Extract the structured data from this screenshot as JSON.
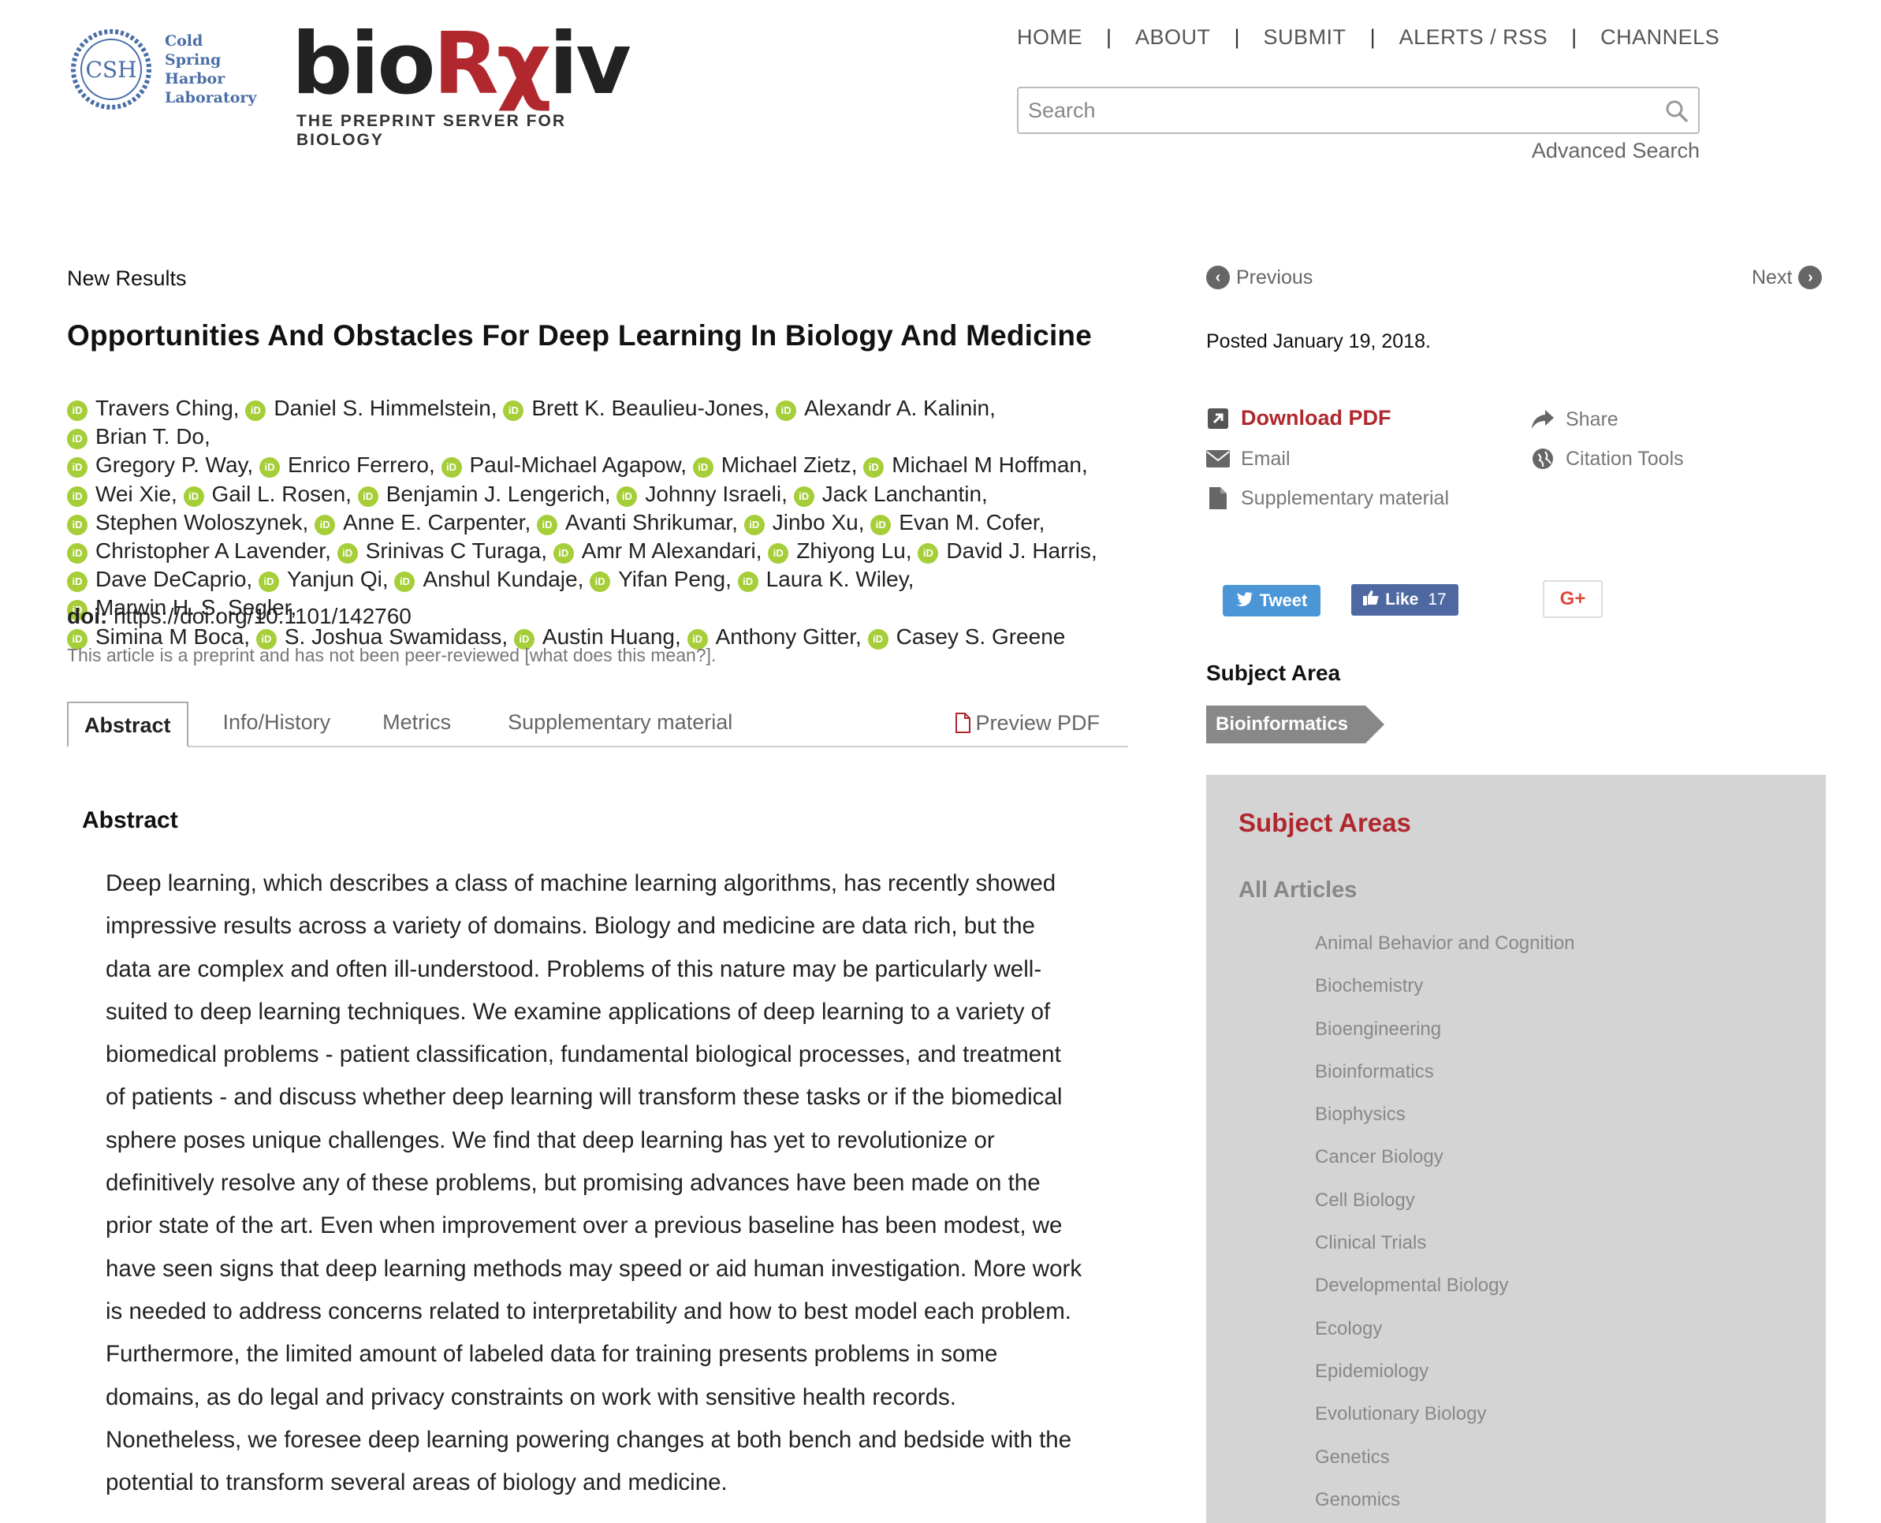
{
  "header": {
    "csh_text": [
      "Cold",
      "Spring",
      "Harbor",
      "Laboratory"
    ],
    "csh_monogram": "CSH",
    "brand_pre": "bio",
    "brand_accent": "Rχ",
    "brand_post": "iv",
    "tagline": "THE PREPRINT SERVER FOR BIOLOGY",
    "nav": [
      "HOME",
      "ABOUT",
      "SUBMIT",
      "ALERTS / RSS",
      "CHANNELS"
    ],
    "nav_separator": "|",
    "search_placeholder": "Search",
    "advanced_search": "Advanced Search",
    "icons": {
      "search": "search-icon"
    }
  },
  "article": {
    "label": "New Results",
    "title": "Opportunities And Obstacles For Deep Learning In Biology And Medicine",
    "orcid_badge": "iD",
    "authors": [
      "Travers Ching,",
      "Daniel S. Himmelstein,",
      "Brett K. Beaulieu-Jones,",
      "Alexandr A. Kalinin,",
      "Brian T. Do,",
      "Gregory P. Way,",
      "Enrico Ferrero,",
      "Paul-Michael Agapow,",
      "Michael Zietz,",
      "Michael M Hoffman,",
      "Wei Xie,",
      "Gail L. Rosen,",
      "Benjamin J. Lengerich,",
      "Johnny Israeli,",
      "Jack Lanchantin,",
      "Stephen Woloszynek,",
      "Anne E. Carpenter,",
      "Avanti Shrikumar,",
      "Jinbo Xu,",
      "Evan M. Cofer,",
      "Christopher A Lavender,",
      "Srinivas C Turaga,",
      "Amr M Alexandari,",
      "Zhiyong Lu,",
      "David J. Harris,",
      "Dave DeCaprio,",
      "Yanjun Qi,",
      "Anshul Kundaje,",
      "Yifan Peng,",
      "Laura K. Wiley,",
      "Marwin H. S. Segler,",
      "Simina M Boca,",
      "S. Joshua Swamidass,",
      "Austin Huang,",
      "Anthony Gitter,",
      "Casey S. Greene"
    ],
    "doi_label": "doi:",
    "doi_url": "https://doi.org/10.1101/142760",
    "preprint_note": "This article is a preprint and has not been peer-reviewed",
    "preprint_link": "[what does this mean?].",
    "tabs": [
      "Abstract",
      "Info/History",
      "Metrics",
      "Supplementary material"
    ],
    "preview_pdf": "Preview PDF",
    "abstract_heading": "Abstract",
    "abstract_lines": [
      "Deep learning, which describes a class of machine learning algorithms, has recently showed",
      "impressive results across a variety of domains. Biology and medicine are data rich, but the",
      "data are complex and often ill-understood. Problems of this nature may be particularly well-",
      "suited to deep learning techniques. We examine applications of deep learning to a variety of",
      "biomedical problems - patient classification, fundamental biological processes, and treatment",
      "of patients - and discuss whether deep learning will transform these tasks or if the biomedical",
      "sphere poses unique challenges. We find that deep learning has yet to revolutionize or",
      "definitively resolve any of these problems, but promising advances have been made on the",
      "prior state of the art. Even when improvement over a previous baseline has been modest, we",
      "have seen signs that deep learning methods may speed or aid human investigation. More work",
      "is needed to address concerns related to interpretability and how to best model each problem.",
      "Furthermore, the limited amount of labeled data for training presents problems in some",
      "domains, as do legal and privacy constraints on work with sensitive health records.",
      "Nonetheless, we foresee deep learning powering changes at both bench and bedside with the",
      "potential to transform several areas of biology and medicine."
    ]
  },
  "sidebar": {
    "previous": "Previous",
    "next": "Next",
    "posted": "Posted January 19, 2018.",
    "download_pdf": "Download PDF",
    "email": "Email",
    "supplementary": "Supplementary material",
    "share": "Share",
    "citation_tools": "Citation Tools",
    "tweet": "Tweet",
    "like": "Like",
    "like_count": "17",
    "gplus": "G+",
    "subject_heading": "Subject Area",
    "subject_tag": "Bioinformatics",
    "areas_heading": "Subject Areas",
    "all_articles": "All Articles",
    "areas": [
      "Animal Behavior and Cognition",
      "Biochemistry",
      "Bioengineering",
      "Bioinformatics",
      "Biophysics",
      "Cancer Biology",
      "Cell Biology",
      "Clinical Trials",
      "Developmental Biology",
      "Ecology",
      "Epidemiology",
      "Evolutionary Biology",
      "Genetics",
      "Genomics"
    ],
    "colors": {
      "brand_red": "#b0282e",
      "orcid_green": "#a6ce39",
      "twitter_blue": "#4a96d6",
      "facebook_blue": "#4e69a2",
      "panel_gray": "#d4d4d4"
    }
  }
}
